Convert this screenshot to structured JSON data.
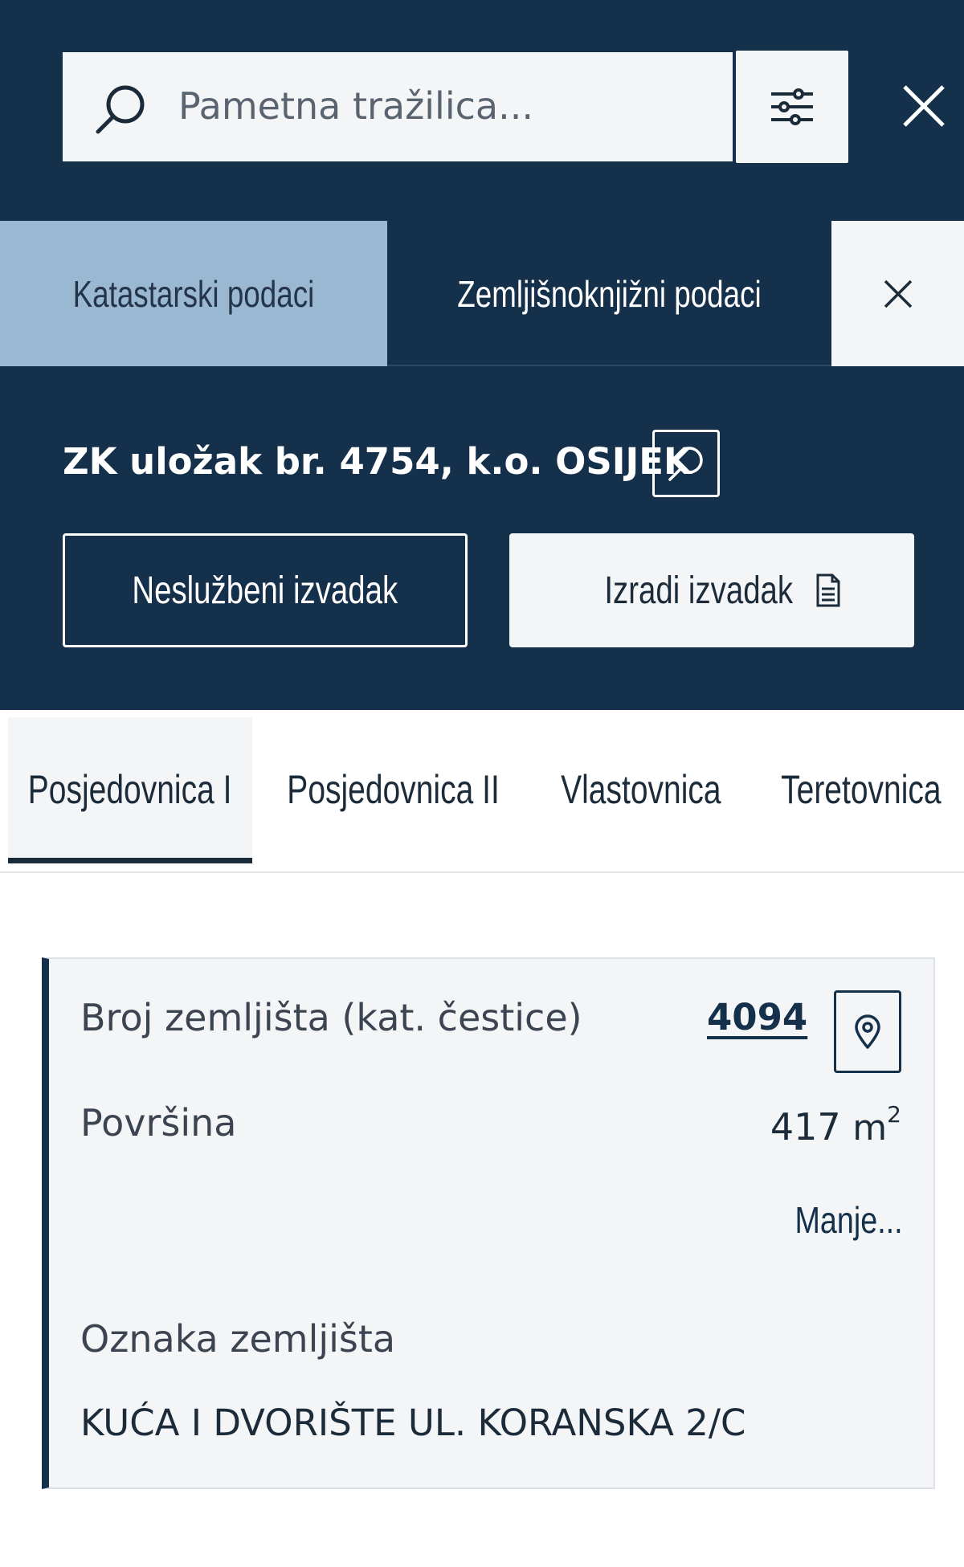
{
  "search": {
    "placeholder": "Pametna tražilica..."
  },
  "data_tabs": [
    {
      "label": "Katastarski podaci",
      "active": false
    },
    {
      "label": "Zemljišnoknjižni podaci",
      "active": true
    }
  ],
  "record": {
    "title": "ZK uložak br. 4754, k.o. OSIJEK",
    "unofficial_extract_label": "Neslužbeni izvadak",
    "create_extract_label": "Izradi izvadak"
  },
  "section_tabs": [
    {
      "label": "Posjedovnica I",
      "active": true
    },
    {
      "label": "Posjedovnica II",
      "active": false
    },
    {
      "label": "Vlastovnica",
      "active": false
    },
    {
      "label": "Teretovnica",
      "active": false
    }
  ],
  "parcel": {
    "number_label": "Broj zemljišta (kat. čestice)",
    "number": "4094",
    "area_label": "Površina",
    "area_value": "417",
    "area_unit": "m",
    "area_unit_exponent": "2",
    "toggle_label": "Manje...",
    "land_mark_label": "Oznaka zemljišta",
    "land_mark_value": "KUĆA I DVORIŠTE UL. KORANSKA 2/C"
  },
  "icons": {
    "search": "search-icon",
    "filter": "sliders-icon",
    "close": "close-icon",
    "document": "document-icon",
    "map_pin": "map-pin-icon"
  },
  "colors": {
    "header_navy": "#15304b",
    "active_tab_light_blue": "#9bb8d3",
    "panel_light": "#f4f5f7",
    "link": "#15304b"
  }
}
